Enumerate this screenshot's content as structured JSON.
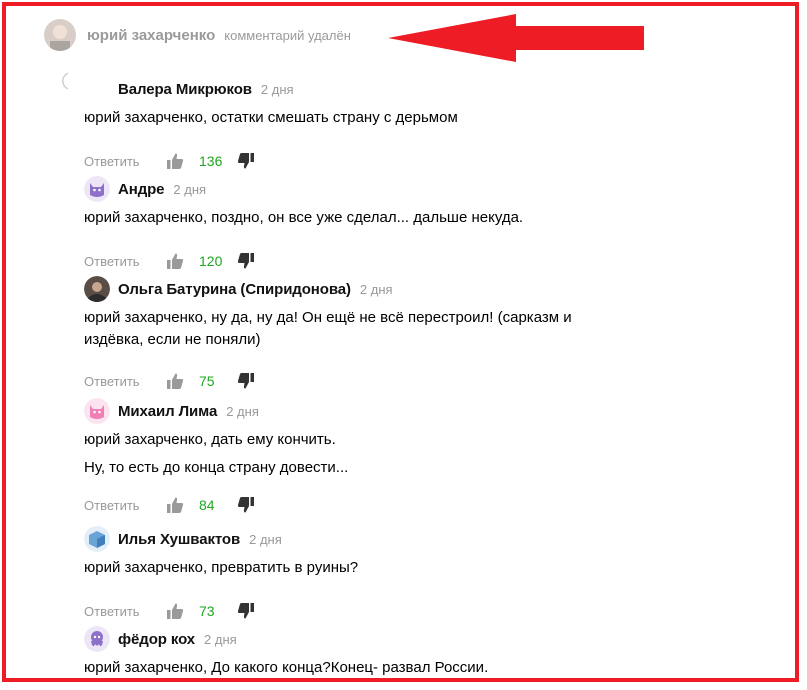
{
  "colors": {
    "frame": "#ee1c24",
    "likes": "#1ea81e",
    "muted": "#999999"
  },
  "top_comment": {
    "author": "юрий захарченко",
    "status": "комментарий удалён"
  },
  "reply_label": "Ответить",
  "comments": [
    {
      "author": "Валера Микрюков",
      "time": "2 дня",
      "lines": [
        "юрий захарченко, остатки смешать страну с дерьмом"
      ],
      "likes": "136",
      "avatar": "none"
    },
    {
      "author": "Андре",
      "time": "2 дня",
      "lines": [
        "юрий захарченко, поздно, он все уже сделал... дальше некуда."
      ],
      "likes": "120",
      "avatar": "purple-cat"
    },
    {
      "author": "Ольга Батурина (Спиридонова)",
      "time": "2 дня",
      "lines": [
        "юрий захарченко, ну да, ну да! Он ещё не всё перестроил! (сарказм и",
        "издёвка, если не поняли)"
      ],
      "likes": "75",
      "avatar": "photo"
    },
    {
      "author": "Михаил Лима",
      "time": "2 дня",
      "lines": [
        "юрий захарченко, дать ему кончить.",
        "Ну, то есть до конца страну довести..."
      ],
      "likes": "84",
      "avatar": "pink-cat"
    },
    {
      "author": "Илья Хушвактов",
      "time": "2 дня",
      "lines": [
        "юрий захарченко, превратить в руины?"
      ],
      "likes": "73",
      "avatar": "blue-cube"
    },
    {
      "author": "фёдор кох",
      "time": "2 дня",
      "lines": [
        "юрий захарченко, До какого конца?Конец- развал России."
      ],
      "likes": "",
      "avatar": "purple-octopus"
    }
  ]
}
